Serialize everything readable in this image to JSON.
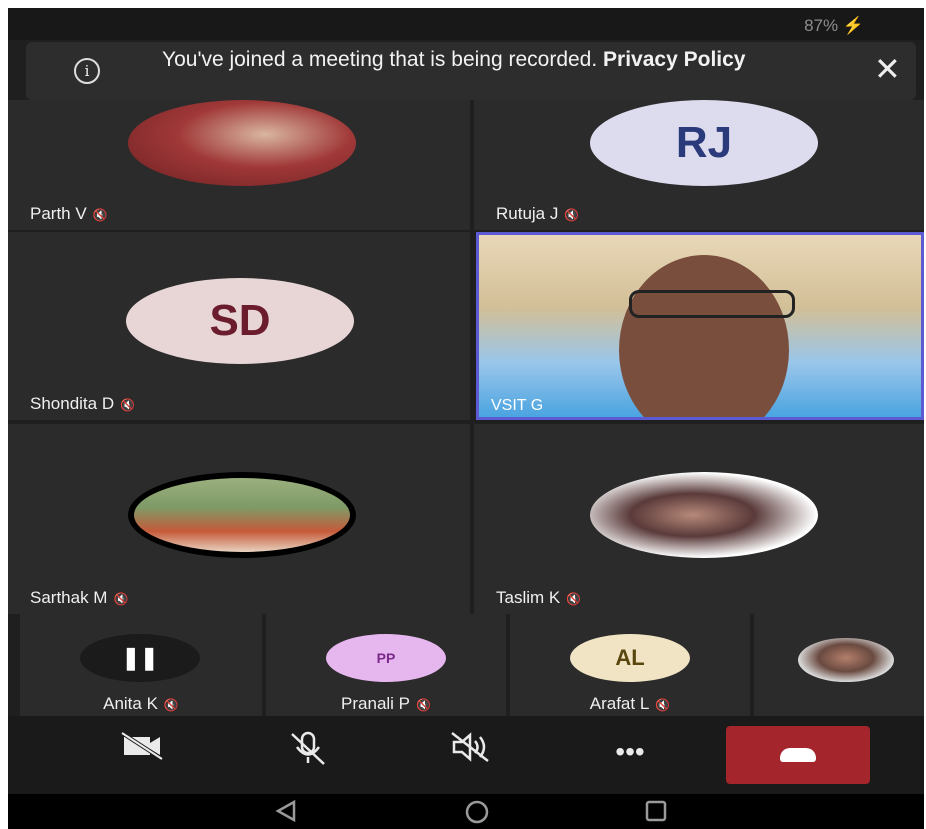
{
  "status": {
    "battery": "87%",
    "charging_icon": "bolt-icon"
  },
  "banner": {
    "message": "You've joined a meeting that is being recorded.",
    "link": "Privacy Policy"
  },
  "participants": [
    {
      "name": "Parth V",
      "avatar": "photo",
      "muted": true
    },
    {
      "name": "Rutuja J",
      "initials": "RJ",
      "avatar_color": "#dcdcee",
      "text_color": "#2b3a7a",
      "muted": true
    },
    {
      "name": "Shondita D",
      "initials": "SD",
      "avatar_color": "#e8d6d6",
      "text_color": "#6b1d2e",
      "muted": true
    },
    {
      "name": "VSIT G",
      "avatar": "video",
      "speaking": true
    },
    {
      "name": "Sarthak M",
      "avatar": "photo",
      "muted": true
    },
    {
      "name": "Taslim K",
      "avatar": "photo",
      "muted": true
    }
  ],
  "strip": [
    {
      "name": "Anita K",
      "avatar": "paused",
      "muted": true
    },
    {
      "name": "Pranali P",
      "initials": "PP",
      "avatar_color": "#e6b7ee",
      "text_color": "#7a2a8a",
      "muted": true
    },
    {
      "name": "Arafat L",
      "initials": "AL",
      "avatar_color": "#f1e4c4",
      "text_color": "#5a4710",
      "muted": true
    },
    {
      "name": "",
      "avatar": "photo"
    }
  ],
  "toolbar": {
    "camera": "camera-off-icon",
    "mic": "mic-off-icon",
    "speaker": "speaker-off-icon",
    "more": "•••",
    "hangup": "hang-up-icon"
  },
  "accent": "#5d5bd4",
  "hangup_color": "#a4262c"
}
